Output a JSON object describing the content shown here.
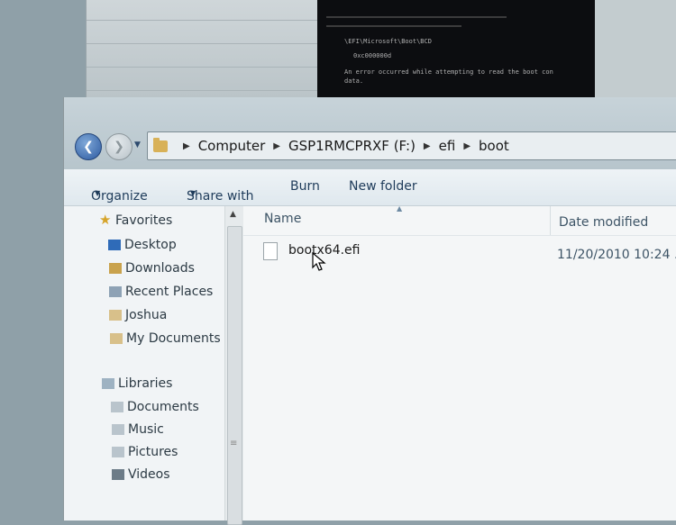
{
  "address": {
    "crumbs": [
      "Computer",
      "GSP1RMCPRXF (F:)",
      "efi",
      "boot"
    ]
  },
  "toolbar": {
    "organize": "Organize",
    "share_with": "Share with",
    "burn": "Burn",
    "new_folder": "New folder"
  },
  "nav": {
    "favorites": "Favorites",
    "desktop": "Desktop",
    "downloads": "Downloads",
    "recent_places": "Recent Places",
    "joshua": "Joshua",
    "my_documents": "My Documents",
    "libraries": "Libraries",
    "documents": "Documents",
    "music": "Music",
    "pictures": "Pictures",
    "videos": "Videos"
  },
  "columns": {
    "name": "Name",
    "date_modified": "Date modified"
  },
  "files": [
    {
      "name": "bootx64.efi",
      "date": "11/20/2010 10:24 ..."
    }
  ],
  "console": {
    "line1": "\\EFI\\Microsoft\\Boot\\BCD",
    "line2": "0xc000000d",
    "line3": "An error occurred while attempting to read the boot con",
    "line4": "data."
  },
  "icons": {
    "back": "back-arrow-icon",
    "forward": "forward-arrow-icon",
    "folder": "folder-icon",
    "star": "star-icon",
    "file": "file-icon",
    "cursor": "mouse-cursor-icon"
  },
  "colors": {
    "accent": "#2d5aa0",
    "folder": "#d8b158",
    "toolbar_text": "#1e3b5a"
  }
}
